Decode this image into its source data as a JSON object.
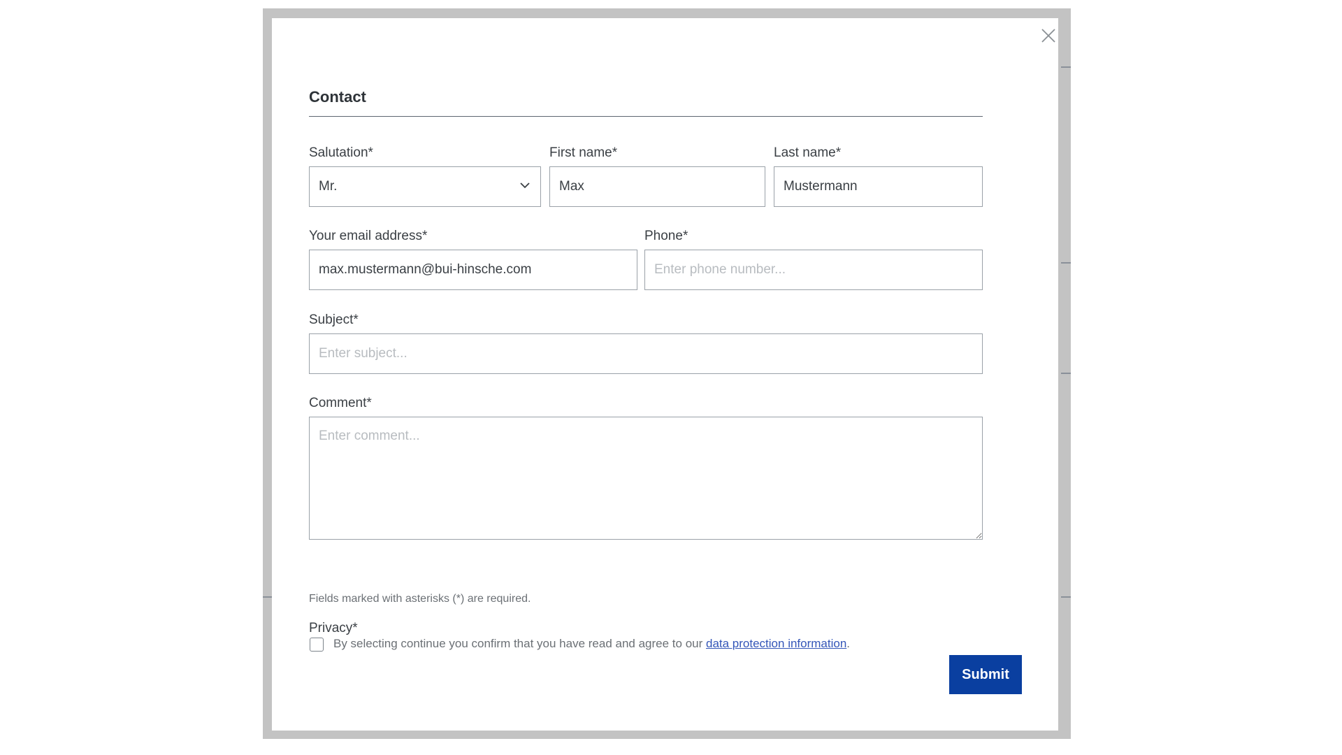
{
  "modal": {
    "title": "Contact",
    "close_icon": "close-icon",
    "fields": {
      "salutation": {
        "label": "Salutation*",
        "value": "Mr.",
        "icon": "chevron-down-icon"
      },
      "first_name": {
        "label": "First name*",
        "value": "Max",
        "placeholder": ""
      },
      "last_name": {
        "label": "Last name*",
        "value": "Mustermann",
        "placeholder": ""
      },
      "email": {
        "label": "Your email address*",
        "value": "max.mustermann@bui-hinsche.com",
        "placeholder": ""
      },
      "phone": {
        "label": "Phone*",
        "value": "",
        "placeholder": "Enter phone number..."
      },
      "subject": {
        "label": "Subject*",
        "value": "",
        "placeholder": "Enter subject..."
      },
      "comment": {
        "label": "Comment*",
        "value": "",
        "placeholder": "Enter comment..."
      }
    },
    "required_hint": "Fields marked with asterisks (*) are required.",
    "privacy": {
      "label": "Privacy*",
      "checked": false,
      "consent_text": "By selecting continue you confirm that you have read and agree to our ",
      "link_text": "data protection information",
      "suffix": "."
    },
    "submit_label": "Submit"
  },
  "colors": {
    "submit_bg": "#0a3fa0",
    "link": "#3456b8",
    "overlay": "#c3c3c3"
  }
}
